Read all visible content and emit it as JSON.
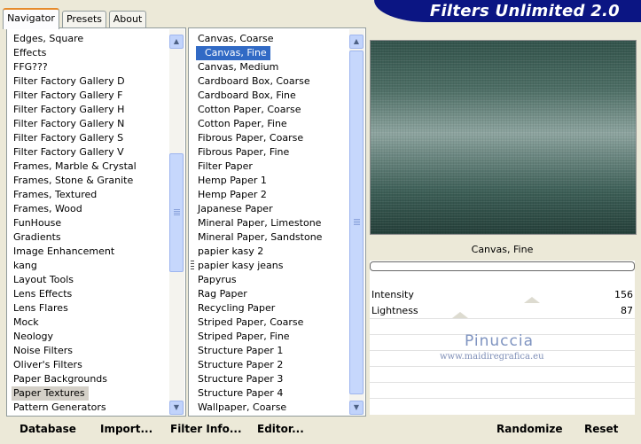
{
  "app": {
    "title": "Filters Unlimited 2.0"
  },
  "tabs": [
    {
      "label": "Navigator",
      "active": true
    },
    {
      "label": "Presets",
      "active": false
    },
    {
      "label": "About",
      "active": false
    }
  ],
  "categories": {
    "items": [
      "Edges, Square",
      "Effects",
      "FFG???",
      "Filter Factory Gallery D",
      "Filter Factory Gallery F",
      "Filter Factory Gallery H",
      "Filter Factory Gallery N",
      "Filter Factory Gallery S",
      "Filter Factory Gallery V",
      "Frames, Marble & Crystal",
      "Frames, Stone & Granite",
      "Frames, Textured",
      "Frames, Wood",
      "FunHouse",
      "Gradients",
      "Image Enhancement",
      "kang",
      "Layout Tools",
      "Lens Effects",
      "Lens Flares",
      "Mock",
      "Neology",
      "Noise Filters",
      "Oliver's Filters",
      "Paper Backgrounds",
      "Paper Textures",
      "Pattern Generators"
    ],
    "selected_index": 25
  },
  "filters": {
    "items": [
      "Canvas, Coarse",
      "Canvas, Fine",
      "Canvas, Medium",
      "Cardboard Box, Coarse",
      "Cardboard Box, Fine",
      "Cotton Paper, Coarse",
      "Cotton Paper, Fine",
      "Fibrous Paper, Coarse",
      "Fibrous Paper, Fine",
      "Filter Paper",
      "Hemp Paper 1",
      "Hemp Paper 2",
      "Japanese Paper",
      "Mineral Paper, Limestone",
      "Mineral Paper, Sandstone",
      "papier kasy 2",
      "papier kasy jeans",
      "Papyrus",
      "Rag Paper",
      "Recycling Paper",
      "Striped Paper, Coarse",
      "Striped Paper, Fine",
      "Structure Paper 1",
      "Structure Paper 2",
      "Structure Paper 3",
      "Structure Paper 4",
      "Wallpaper, Coarse"
    ],
    "selected_index": 1
  },
  "preview": {
    "filter_name": "Canvas, Fine"
  },
  "params": [
    {
      "label": "Intensity",
      "value": "156"
    },
    {
      "label": "Lightness",
      "value": "87"
    }
  ],
  "watermark": {
    "name": "Pinuccia",
    "url": "www.maidiregrafica.eu"
  },
  "buttons": {
    "database": "Database",
    "import": "Import...",
    "filter_info": "Filter Info...",
    "editor": "Editor...",
    "randomize": "Randomize",
    "reset": "Reset"
  },
  "icons": {
    "scroll_up": "chevron-up-icon",
    "scroll_down": "chevron-down-icon"
  },
  "colors": {
    "banner": "#0b1583",
    "selection": "#316ac5",
    "active_tab": "#e68b2c"
  }
}
